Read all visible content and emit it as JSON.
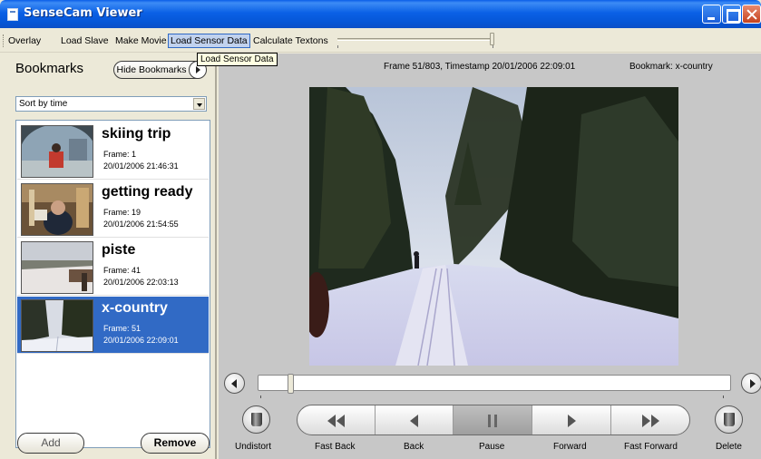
{
  "window": {
    "title": "SenseCam Viewer"
  },
  "menu": {
    "items": [
      "Overlay",
      "Load Slave",
      "Make Movie",
      "Load Sensor Data",
      "Calculate Textons"
    ],
    "tooltip": "Load Sensor Data"
  },
  "sidebar": {
    "title": "Bookmarks",
    "hide_label": "Hide Bookmarks",
    "sort_value": "Sort by time",
    "bookmarks": [
      {
        "name": "skiing trip",
        "frame": "Frame: 1",
        "time": "20/01/2006 21:46:31"
      },
      {
        "name": "getting ready",
        "frame": "Frame: 19",
        "time": "20/01/2006 21:54:55"
      },
      {
        "name": "piste",
        "frame": "Frame: 41",
        "time": "20/01/2006 22:03:13"
      },
      {
        "name": "x-country",
        "frame": "Frame: 51",
        "time": "20/01/2006 22:09:01"
      }
    ],
    "selected_bookmark": "x-country",
    "add_label": "Add",
    "remove_label": "Remove"
  },
  "viewer": {
    "frame_info": "Frame 51/803, Timestamp 20/01/2006 22:09:01",
    "bookmark_info": "Bookmark:   x-country",
    "current_frame": 51,
    "total_frames": 803
  },
  "controls": {
    "undistort": "Undistort",
    "fast_back": "Fast Back",
    "back": "Back",
    "pause": "Pause",
    "forward": "Forward",
    "fast_forward": "Fast Forward",
    "delete": "Delete"
  },
  "colors": {
    "selection": "#316ac5",
    "titlebar": "#0b61e6",
    "main_bg": "#c7c7c7"
  }
}
